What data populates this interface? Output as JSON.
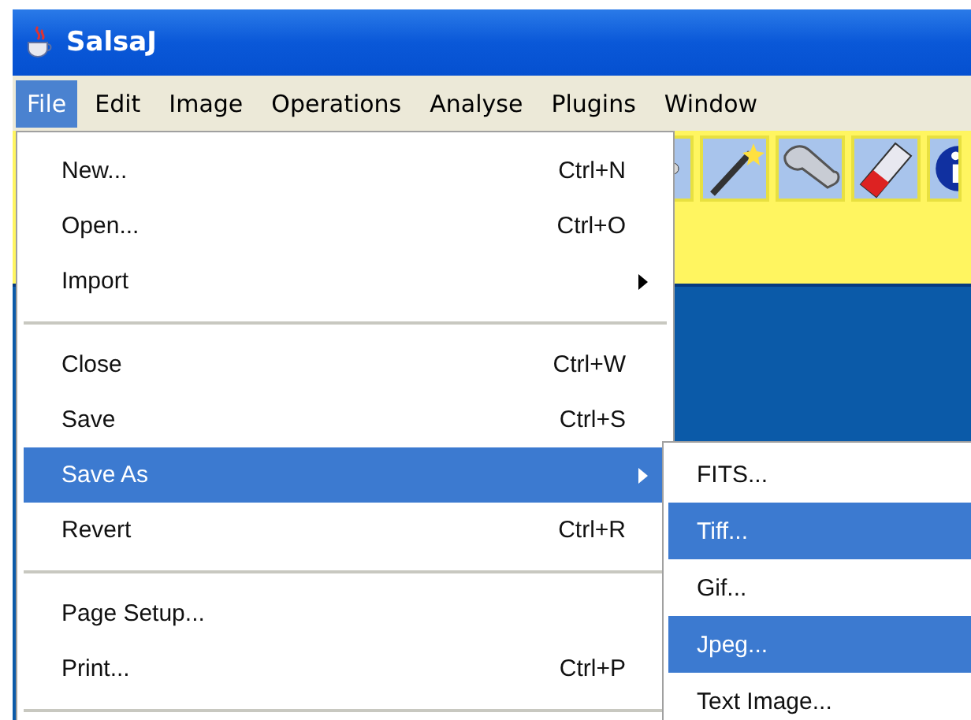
{
  "window": {
    "title": "SalsaJ"
  },
  "menubar": [
    {
      "label": "File",
      "selected": true
    },
    {
      "label": "Edit",
      "selected": false
    },
    {
      "label": "Image",
      "selected": false
    },
    {
      "label": "Operations",
      "selected": false
    },
    {
      "label": "Analyse",
      "selected": false
    },
    {
      "label": "Plugins",
      "selected": false
    },
    {
      "label": "Window",
      "selected": false
    }
  ],
  "file_menu": [
    {
      "kind": "item",
      "label": "New...",
      "shortcut": "Ctrl+N",
      "submenu": false,
      "selected": false
    },
    {
      "kind": "item",
      "label": "Open...",
      "shortcut": "Ctrl+O",
      "submenu": false,
      "selected": false
    },
    {
      "kind": "item",
      "label": "Import",
      "submenu": true,
      "selected": false
    },
    {
      "kind": "separator"
    },
    {
      "kind": "item",
      "label": "Close",
      "shortcut": "Ctrl+W",
      "submenu": false,
      "selected": false
    },
    {
      "kind": "item",
      "label": "Save",
      "shortcut": "Ctrl+S",
      "submenu": false,
      "selected": false
    },
    {
      "kind": "item",
      "label": "Save As",
      "submenu": true,
      "selected": true
    },
    {
      "kind": "item",
      "label": "Revert",
      "shortcut": "Ctrl+R",
      "submenu": false,
      "selected": false
    },
    {
      "kind": "separator"
    },
    {
      "kind": "item",
      "label": "Page Setup...",
      "submenu": false,
      "selected": false
    },
    {
      "kind": "item",
      "label": "Print...",
      "shortcut": "Ctrl+P",
      "submenu": false,
      "selected": false
    },
    {
      "kind": "separator"
    }
  ],
  "save_as_menu": [
    {
      "label": "FITS...",
      "selected": false
    },
    {
      "label": "Tiff...",
      "selected": true
    },
    {
      "label": "Gif...",
      "selected": false
    },
    {
      "label": "Jpeg...",
      "selected": true
    },
    {
      "label": "Text Image...",
      "selected": false
    }
  ]
}
